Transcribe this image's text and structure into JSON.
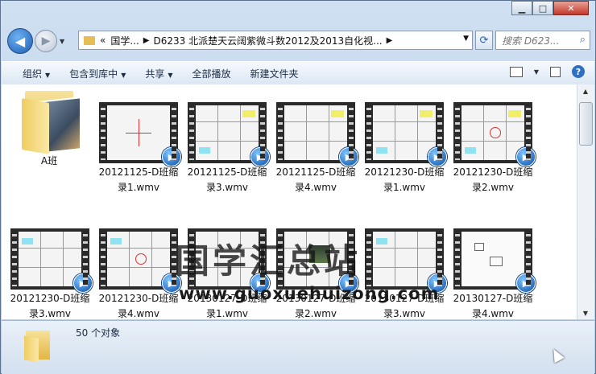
{
  "window": {
    "minimize": "▁",
    "maximize": "□",
    "close": "✕"
  },
  "address": {
    "chevron_prefix": "«",
    "segment1": "国学...",
    "segment2": "D6233 北派楚天云阔紫微斗数2012及2013自化视..."
  },
  "search": {
    "placeholder": "搜索 D623..."
  },
  "toolbar": {
    "organize": "组织",
    "include_in_library": "包含到库中",
    "share": "共享",
    "play_all": "全部播放",
    "new_folder": "新建文件夹"
  },
  "items": [
    {
      "kind": "folder",
      "line1": "A班",
      "line2": ""
    },
    {
      "kind": "video",
      "line1": "20121125-D班缩",
      "line2": "录1.wmv"
    },
    {
      "kind": "video",
      "line1": "20121125-D班缩",
      "line2": "录3.wmv"
    },
    {
      "kind": "video",
      "line1": "20121125-D班缩",
      "line2": "录4.wmv"
    },
    {
      "kind": "video",
      "line1": "20121230-D班缩",
      "line2": "录1.wmv"
    },
    {
      "kind": "video",
      "line1": "20121230-D班缩",
      "line2": "录2.wmv"
    },
    {
      "kind": "video",
      "line1": "20121230-D班缩",
      "line2": "录3.wmv"
    },
    {
      "kind": "video",
      "line1": "20121230-D班缩",
      "line2": "录4.wmv"
    },
    {
      "kind": "video",
      "line1": "20130127-D班缩",
      "line2": "录1.wmv"
    },
    {
      "kind": "video",
      "line1": "20130127-D班缩",
      "line2": "录2.wmv"
    },
    {
      "kind": "video",
      "line1": "20130127-D班缩",
      "line2": "录3.wmv"
    },
    {
      "kind": "video",
      "line1": "20130127-D班缩",
      "line2": "录4.wmv"
    }
  ],
  "watermark": {
    "text": "国学汇总站",
    "url": "www.guoxuehuizong.com"
  },
  "status": {
    "count": "50 个对象"
  }
}
